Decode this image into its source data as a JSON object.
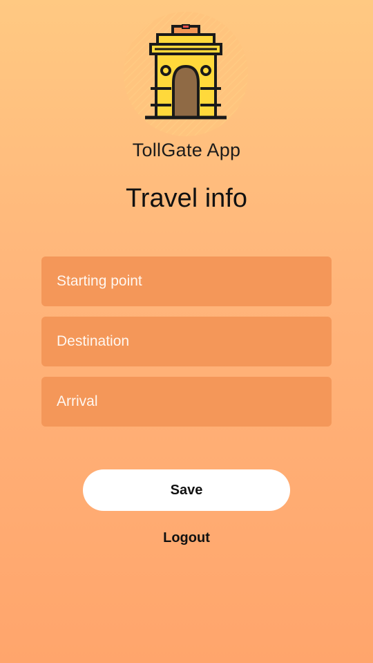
{
  "header": {
    "app_name": "TollGate App",
    "logo_icon": "india-gate-icon"
  },
  "page": {
    "title": "Travel info"
  },
  "form": {
    "starting_point_placeholder": "Starting point",
    "destination_placeholder": "Destination",
    "arrival_placeholder": "Arrival"
  },
  "actions": {
    "save_label": "Save",
    "logout_label": "Logout"
  },
  "colors": {
    "background_top": "#ffc982",
    "background_bottom": "#ffa56c",
    "field_background": "#f49759",
    "button_background": "#ffffff",
    "logo_yellow": "#ffd93b",
    "logo_door": "#8f6a45"
  }
}
